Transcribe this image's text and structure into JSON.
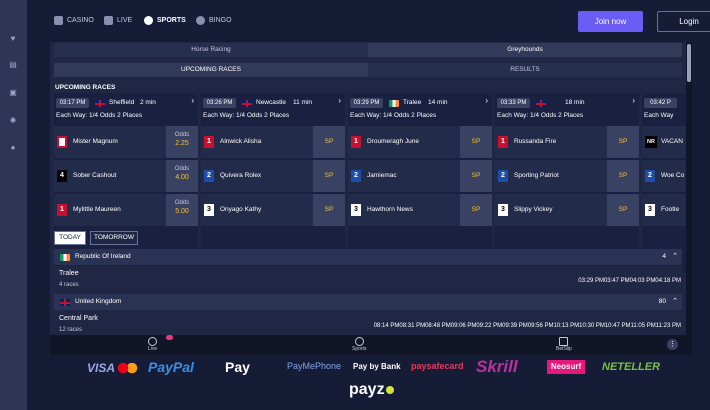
{
  "nav": {
    "casino": "CASINO",
    "live": "LIVE",
    "sports": "SPORTS",
    "bingo": "BINGO",
    "join": "Join now",
    "login": "Login"
  },
  "sport_tabs": [
    "Horse Racing",
    "Greyhounds"
  ],
  "view_tabs": [
    "UPCOMING RACES",
    "RESULTS"
  ],
  "upcoming_title": "UPCOMING RACES",
  "races": [
    {
      "time": "03:17 PM",
      "venue": "Sheffield",
      "mins": "2 min",
      "eachway": "Each Way: 1/4 Odds 2 Places",
      "runners": [
        {
          "num": "",
          "name": "Mister Magnum",
          "odds_label": "Odds",
          "odds": "2.25"
        },
        {
          "num": "4",
          "name": "Sober Cashout",
          "odds_label": "Odds",
          "odds": "4.00"
        },
        {
          "num": "1",
          "name": "Mylittle Maureen",
          "odds_label": "Odds",
          "odds": "5.00"
        }
      ]
    },
    {
      "time": "03:26 PM",
      "venue": "Newcastle",
      "mins": "11 min",
      "eachway": "Each Way: 1/4 Odds 2 Places",
      "runners": [
        {
          "num": "1",
          "name": "Alnwick Alisha",
          "sp": "SP"
        },
        {
          "num": "2",
          "name": "Quivera Rolex",
          "sp": "SP"
        },
        {
          "num": "3",
          "name": "Onyago Kathy",
          "sp": "SP"
        }
      ]
    },
    {
      "time": "03:29 PM",
      "venue": "Tralee",
      "mins": "14 min",
      "eachway": "Each Way: 1/4 Odds 2 Places",
      "runners": [
        {
          "num": "1",
          "name": "Droumeragh June",
          "sp": "SP"
        },
        {
          "num": "2",
          "name": "Jamiemac",
          "sp": "SP"
        },
        {
          "num": "3",
          "name": "Hawthorn News",
          "sp": "SP"
        }
      ]
    },
    {
      "time": "03:33 PM",
      "venue": "",
      "mins": "18 min",
      "eachway": "Each Way: 1/4 Odds 2 Places",
      "runners": [
        {
          "num": "1",
          "name": "Russanda Fire",
          "sp": "SP"
        },
        {
          "num": "2",
          "name": "Sporting Patriot",
          "sp": "SP"
        },
        {
          "num": "3",
          "name": "Slippy Vickey",
          "sp": "SP"
        }
      ]
    },
    {
      "time": "03:42 P",
      "venue": "",
      "mins": "",
      "eachway": "Each Way",
      "runners": [
        {
          "num": "NR",
          "name": "VACAN"
        },
        {
          "num": "2",
          "name": "Woe Co"
        },
        {
          "num": "3",
          "name": "Footle"
        }
      ]
    }
  ],
  "day_tabs": {
    "today": "TODAY",
    "tomorrow": "TOMORROW"
  },
  "countries": [
    {
      "name": "Republic Of Ireland",
      "count": "4",
      "meeting": {
        "name": "Tralee",
        "races": "4 races",
        "times": "03:29 PM03:47 PM04:03 PM04:18 PM"
      }
    },
    {
      "name": "United Kingdom",
      "count": "80",
      "meeting": {
        "name": "Central Park",
        "races": "12 races",
        "times": "08:14 PM08:31 PM08:48 PM09:06 PM09:22 PM09:39 PM09:56 PM10:13 PM10:30 PM10:47 PM11:05 PM11:23 PM"
      }
    }
  ],
  "bottombar": {
    "live": "Live",
    "sports": "Sports",
    "betslip": "BetSlip",
    "more": "⋮"
  },
  "payments": [
    "VISA",
    "PayPal",
    "Pay",
    "PayMePhone",
    "Pay by Bank",
    "paysafecard",
    "Skrill",
    "Neosurf",
    "NETELLER",
    "payz"
  ],
  "colors": {
    "accent": "#6b5cf5",
    "odds": "#f2c230",
    "background": "#161c36"
  }
}
